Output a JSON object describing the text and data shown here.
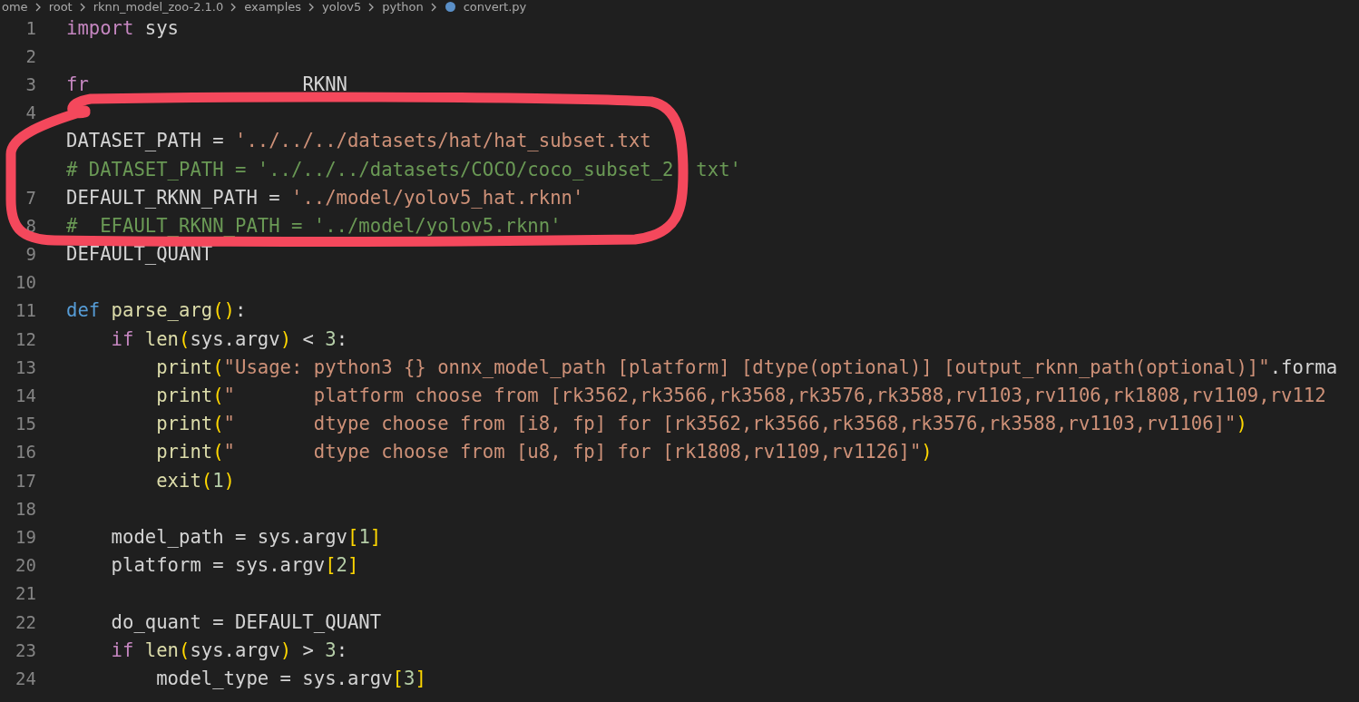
{
  "breadcrumb": {
    "items": [
      "ome",
      "root",
      "rknn_model_zoo-2.1.0",
      "examples",
      "yolov5",
      "python"
    ],
    "file": "convert.py"
  },
  "annotation": {
    "kind": "circle",
    "color": "#f4485c"
  },
  "lines": [
    {
      "n": "1",
      "spans": [
        {
          "text": "import",
          "kind": "ctl"
        },
        {
          "text": " sys",
          "kind": "p"
        }
      ]
    },
    {
      "n": "2"
    },
    {
      "n": "3",
      "spans": [
        {
          "text": "fr",
          "kind": "ctl"
        },
        {
          "text": "                   RKNN",
          "kind": "p"
        }
      ]
    },
    {
      "n": "4"
    },
    {
      "spans": [
        {
          "text": "DATASET_PATH = ",
          "kind": "p"
        },
        {
          "text": "'../../../datasets/hat/hat_subset.txt",
          "kind": "str"
        }
      ]
    },
    {
      "spans": [
        {
          "text": "# DATASET_PATH = '../../../datasets/COCO/coco_subset_2",
          "kind": "cmt"
        },
        {
          "text": "  txt'",
          "kind": "cmt"
        }
      ]
    },
    {
      "n": "7",
      "spans": [
        {
          "text": "DEFAULT_RKNN_PATH = ",
          "kind": "p"
        },
        {
          "text": "'../model/yolov5_hat.rknn'",
          "kind": "str"
        }
      ]
    },
    {
      "n": "8",
      "spans": [
        {
          "text": "#",
          "kind": "cmt"
        },
        {
          "text": "  EFAULT_RKNN_PATH = '../model/yolov5.rknn'",
          "kind": "cmt"
        }
      ]
    },
    {
      "n": "9",
      "spans": [
        {
          "text": "DEFAULT_QUANT",
          "kind": "p"
        }
      ]
    },
    {
      "n": "10"
    },
    {
      "n": "11",
      "spans": [
        {
          "text": "def",
          "kind": "kw"
        },
        {
          "text": " parse_arg",
          "kind": "fn"
        },
        {
          "text": "()",
          "kind": "br"
        },
        {
          "text": ":",
          "kind": "p"
        }
      ],
      "children": [
        {
          "n": "12",
          "spans": [
            {
              "text": "if",
              "kind": "ctl"
            },
            {
              "text": " len",
              "kind": "fn"
            },
            {
              "text": "(",
              "kind": "br"
            },
            {
              "text": "sys.argv",
              "kind": "p"
            },
            {
              "text": ")",
              "kind": "br"
            },
            {
              "text": " < ",
              "kind": "p"
            },
            {
              "text": "3",
              "kind": "num"
            },
            {
              "text": ":",
              "kind": "p"
            }
          ],
          "children": [
            {
              "n": "13",
              "spans": [
                {
                  "text": "print",
                  "kind": "fn"
                },
                {
                  "text": "(",
                  "kind": "br"
                },
                {
                  "text": "\"Usage: python3 {} onnx_model_path [platform] [dtype(optional)] [output_rknn_path(optional)]\"",
                  "kind": "str"
                },
                {
                  "text": ".forma",
                  "kind": "p"
                }
              ]
            },
            {
              "n": "14",
              "spans": [
                {
                  "text": "print",
                  "kind": "fn"
                },
                {
                  "text": "(",
                  "kind": "br"
                },
                {
                  "text": "\"       platform choose from [rk3562,rk3566,rk3568,rk3576,rk3588,rv1103,rv1106,rk1808,rv1109,rv112",
                  "kind": "str"
                }
              ]
            },
            {
              "n": "15",
              "spans": [
                {
                  "text": "print",
                  "kind": "fn"
                },
                {
                  "text": "(",
                  "kind": "br"
                },
                {
                  "text": "\"       dtype choose from [i8, fp] for [rk3562,rk3566,rk3568,rk3576,rk3588,rv1103,rv1106]\"",
                  "kind": "str"
                },
                {
                  "text": ")",
                  "kind": "br"
                }
              ]
            },
            {
              "n": "16",
              "spans": [
                {
                  "text": "print",
                  "kind": "fn"
                },
                {
                  "text": "(",
                  "kind": "br"
                },
                {
                  "text": "\"       dtype choose from [u8, fp] for [rk1808,rv1109,rv1126]\"",
                  "kind": "str"
                },
                {
                  "text": ")",
                  "kind": "br"
                }
              ]
            },
            {
              "n": "17",
              "spans": [
                {
                  "text": "exit",
                  "kind": "fn"
                },
                {
                  "text": "(",
                  "kind": "br"
                },
                {
                  "text": "1",
                  "kind": "num"
                },
                {
                  "text": ")",
                  "kind": "br"
                }
              ]
            }
          ]
        },
        {
          "n": "18"
        },
        {
          "n": "19",
          "spans": [
            {
              "text": "model_path = sys.argv",
              "kind": "p"
            },
            {
              "text": "[",
              "kind": "br"
            },
            {
              "text": "1",
              "kind": "num"
            },
            {
              "text": "]",
              "kind": "br"
            }
          ]
        },
        {
          "n": "20",
          "spans": [
            {
              "text": "platform = sys.argv",
              "kind": "p"
            },
            {
              "text": "[",
              "kind": "br"
            },
            {
              "text": "2",
              "kind": "num"
            },
            {
              "text": "]",
              "kind": "br"
            }
          ]
        },
        {
          "n": "21"
        },
        {
          "n": "22",
          "spans": [
            {
              "text": "do_quant = DEFAULT_QUANT",
              "kind": "p"
            }
          ]
        },
        {
          "n": "23",
          "spans": [
            {
              "text": "if",
              "kind": "ctl"
            },
            {
              "text": " len",
              "kind": "fn"
            },
            {
              "text": "(",
              "kind": "br"
            },
            {
              "text": "sys.argv",
              "kind": "p"
            },
            {
              "text": ")",
              "kind": "br"
            },
            {
              "text": " > ",
              "kind": "p"
            },
            {
              "text": "3",
              "kind": "num"
            },
            {
              "text": ":",
              "kind": "p"
            }
          ],
          "children": [
            {
              "n": "24",
              "spans": [
                {
                  "text": "model_type = sys.argv",
                  "kind": "p"
                },
                {
                  "text": "[",
                  "kind": "br"
                },
                {
                  "text": "3",
                  "kind": "num"
                },
                {
                  "text": "]",
                  "kind": "br"
                }
              ]
            }
          ]
        }
      ]
    }
  ]
}
